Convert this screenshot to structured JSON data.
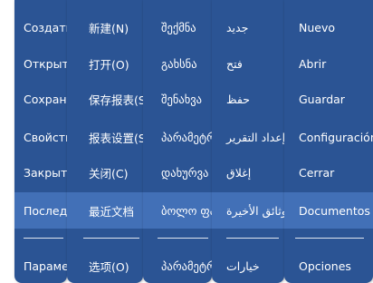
{
  "columns": [
    {
      "lang": "ru",
      "items": [
        {
          "label": "Создать"
        },
        {
          "label": "Открыть"
        },
        {
          "label": "Сохранить"
        },
        {
          "label": "Свойства"
        },
        {
          "label": "Закрыть"
        },
        {
          "label": "Последние",
          "highlighted": true
        },
        {
          "label": "Параметры"
        }
      ]
    },
    {
      "lang": "zh",
      "items": [
        {
          "label": "新建(N)"
        },
        {
          "label": "打开(O)"
        },
        {
          "label": "保存报表(S)"
        },
        {
          "label": "报表设置(S)"
        },
        {
          "label": "关闭(C)"
        },
        {
          "label": "最近文档",
          "highlighted": true
        },
        {
          "label": "选项(O)"
        }
      ]
    },
    {
      "lang": "ka",
      "items": [
        {
          "label": "შექმნა"
        },
        {
          "label": "გახსნა"
        },
        {
          "label": "შენახვა"
        },
        {
          "label": "პარამეტრები"
        },
        {
          "label": "დახურვა"
        },
        {
          "label": "ბოლო ფაილები",
          "highlighted": true
        },
        {
          "label": "პარამეტრები"
        }
      ]
    },
    {
      "lang": "ar",
      "items": [
        {
          "label": "جديد"
        },
        {
          "label": "فتح"
        },
        {
          "label": "حفظ"
        },
        {
          "label": "إعداد التقرير"
        },
        {
          "label": "إغلاق"
        },
        {
          "label": "وثائق الأخيرة",
          "highlighted": true
        },
        {
          "label": "خيارات"
        }
      ]
    },
    {
      "lang": "es",
      "items": [
        {
          "label": "Nuevo"
        },
        {
          "label": "Abrir"
        },
        {
          "label": "Guardar"
        },
        {
          "label": "Configuración"
        },
        {
          "label": "Cerrar"
        },
        {
          "label": "Documentos",
          "highlighted": true
        },
        {
          "label": "Opciones"
        }
      ]
    }
  ],
  "colors": {
    "panel": "#2b5494",
    "highlight": "#4270b7",
    "text": "#ffffff"
  }
}
